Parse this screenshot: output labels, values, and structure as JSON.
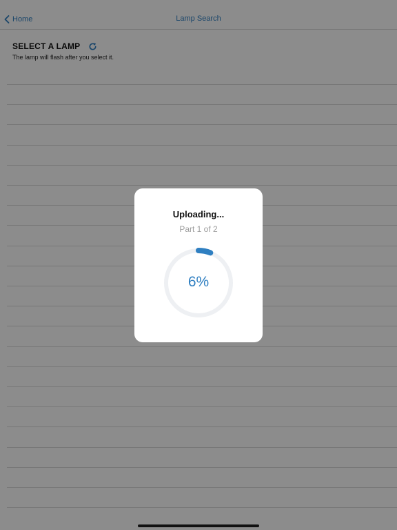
{
  "nav": {
    "back_label": "Home",
    "title": "Lamp Search"
  },
  "header": {
    "title": "SELECT A LAMP",
    "subtitle": "The lamp will flash after you select it."
  },
  "icons": {
    "back": "chevron-left-icon",
    "refresh": "refresh-icon"
  },
  "modal": {
    "title": "Uploading...",
    "subtitle": "Part 1 of 2",
    "percent_label": "6%",
    "progress": 0.06
  },
  "colors": {
    "accent": "#2f7fc1",
    "overlay": "rgba(0,0,0,0.45)",
    "ring_track": "#eef0f3"
  }
}
